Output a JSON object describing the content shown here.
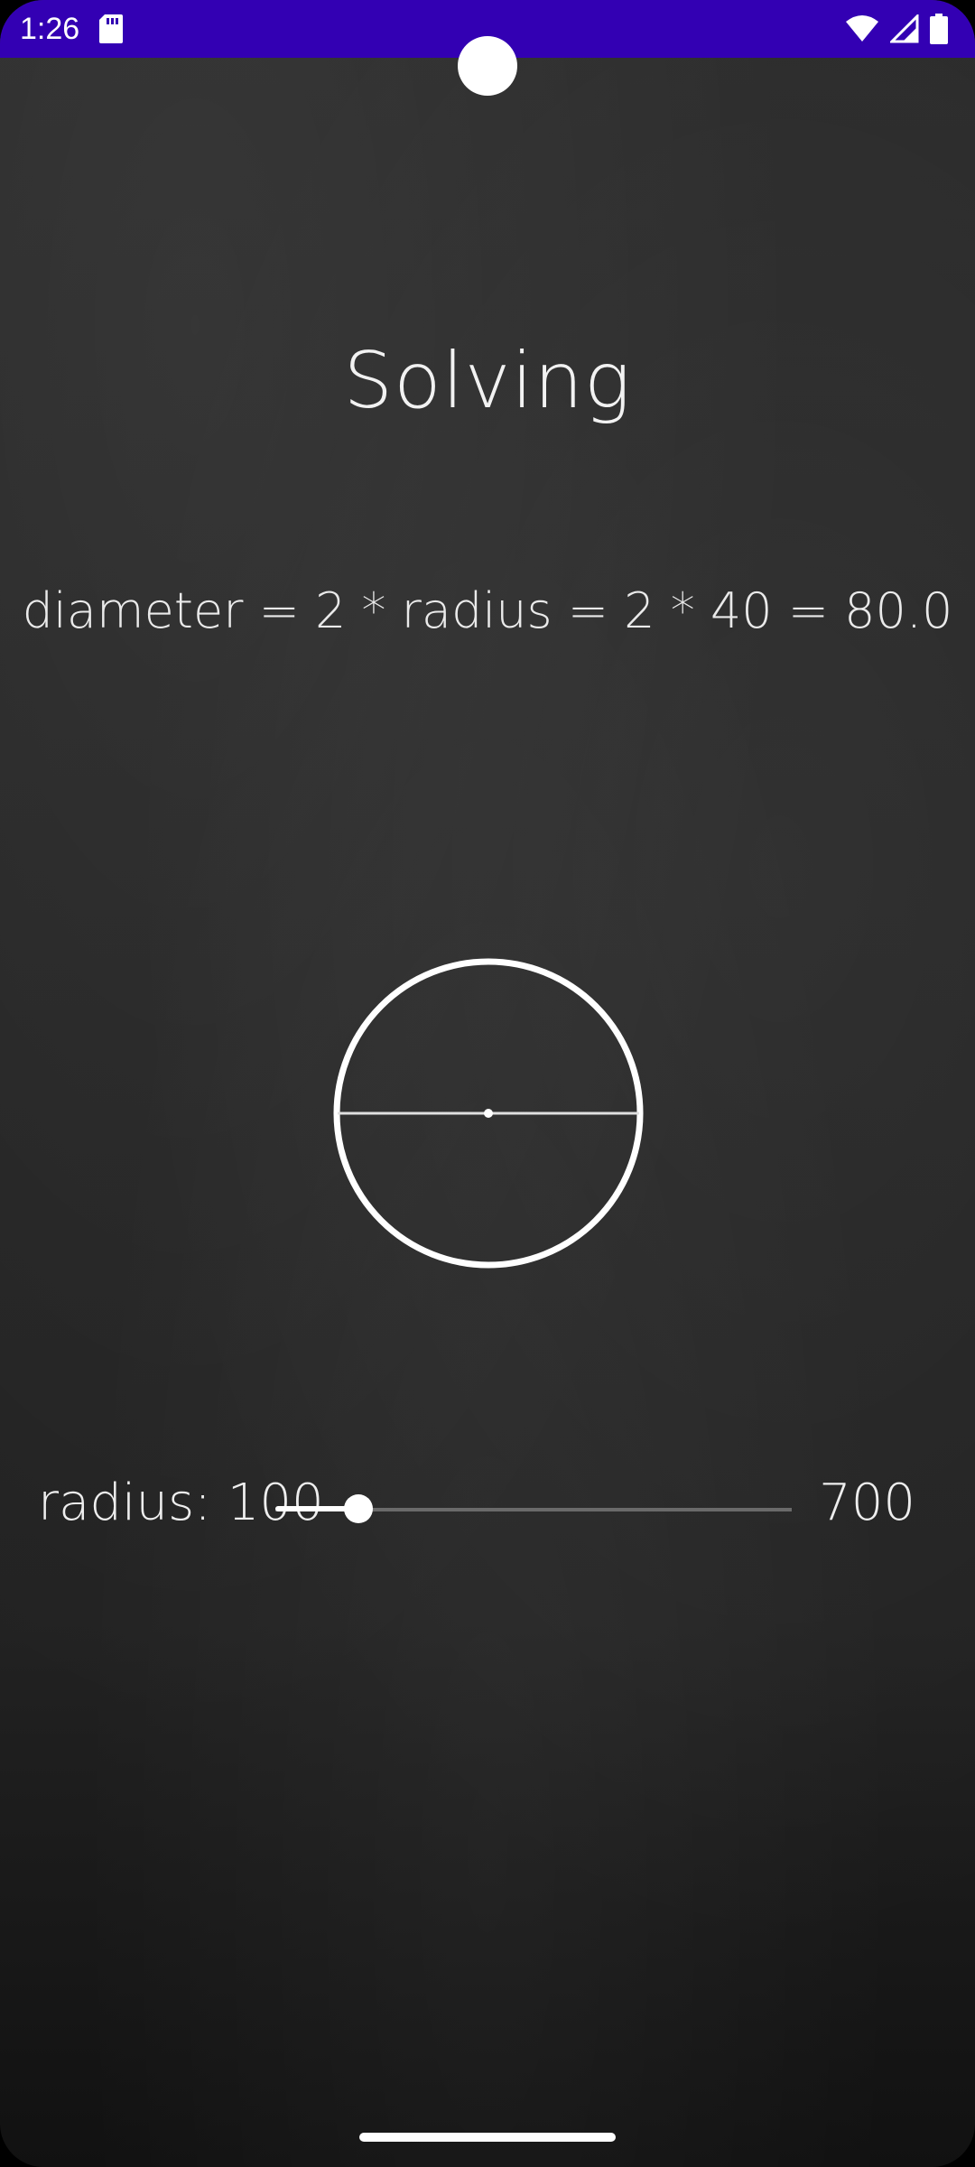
{
  "status_bar": {
    "time": "1:26",
    "icons": [
      "sd-card-icon",
      "wifi-icon",
      "signal-icon",
      "battery-icon"
    ],
    "color": "#3300b3"
  },
  "main": {
    "title": "Solving",
    "formula": "diameter = 2 * radius = 2 * 40 = 80.0"
  },
  "slider": {
    "label": "radius: 100",
    "max_label": "700",
    "value_fraction": 0.16
  },
  "colors": {
    "background": "#262626",
    "text": "#f2f2f2"
  }
}
